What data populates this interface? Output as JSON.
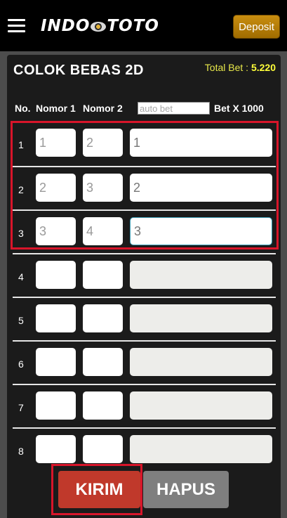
{
  "header": {
    "logo_text_left": "INDO",
    "logo_text_right": "TOTO",
    "deposit_label": "Deposit"
  },
  "game": {
    "title": "COLOK BEBAS 2D",
    "total_bet_label": "Total Bet :",
    "total_bet_value": "5.220"
  },
  "columns": {
    "no": "No.",
    "nomor1": "Nomor 1",
    "nomor2": "Nomor 2",
    "auto_bet_placeholder": "auto bet",
    "bet": "Bet X 1000"
  },
  "rows": [
    {
      "no": "1",
      "nomor1": "1",
      "nomor2": "2",
      "bet": "1"
    },
    {
      "no": "2",
      "nomor1": "2",
      "nomor2": "3",
      "bet": "2"
    },
    {
      "no": "3",
      "nomor1": "3",
      "nomor2": "4",
      "bet": "3"
    },
    {
      "no": "4",
      "nomor1": "",
      "nomor2": "",
      "bet": ""
    },
    {
      "no": "5",
      "nomor1": "",
      "nomor2": "",
      "bet": ""
    },
    {
      "no": "6",
      "nomor1": "",
      "nomor2": "",
      "bet": ""
    },
    {
      "no": "7",
      "nomor1": "",
      "nomor2": "",
      "bet": ""
    },
    {
      "no": "8",
      "nomor1": "",
      "nomor2": "",
      "bet": ""
    }
  ],
  "actions": {
    "submit_label": "KIRIM",
    "clear_label": "HAPUS"
  },
  "colors": {
    "submit": "#c0392b",
    "clear": "#7f7f7f",
    "deposit": "#b57b00",
    "highlight": "#d8152a",
    "total_bet": "#ffff3a"
  },
  "icons": {
    "menu": "hamburger-menu-icon"
  }
}
